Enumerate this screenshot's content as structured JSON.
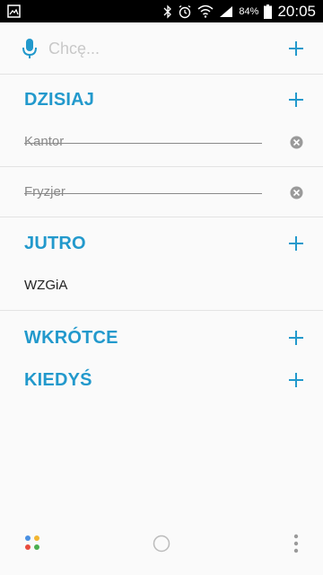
{
  "status_bar": {
    "battery": "84%",
    "time": "20:05",
    "icons": [
      "gallery-notification-icon",
      "bluetooth-icon",
      "alarm-icon",
      "wifi-icon",
      "signal-icon",
      "battery-icon"
    ]
  },
  "input": {
    "placeholder": "Chcę..."
  },
  "sections": {
    "today": {
      "title": "DZISIAJ"
    },
    "tomorrow": {
      "title": "JUTRO"
    },
    "soon": {
      "title": "WKRÓTCE"
    },
    "someday": {
      "title": "KIEDYŚ"
    }
  },
  "tasks": {
    "today": [
      {
        "label": "Kantor",
        "done": true
      },
      {
        "label": "Fryzjer",
        "done": true
      }
    ],
    "tomorrow": [
      {
        "label": "WZGiA",
        "done": false
      }
    ]
  },
  "colors": {
    "accent": "#2299cc",
    "done_text": "#8a8a8a",
    "divider": "#e3e3e3",
    "apps_dots": [
      "#4a90e2",
      "#f2b632",
      "#e84c3d",
      "#4caf50"
    ]
  }
}
